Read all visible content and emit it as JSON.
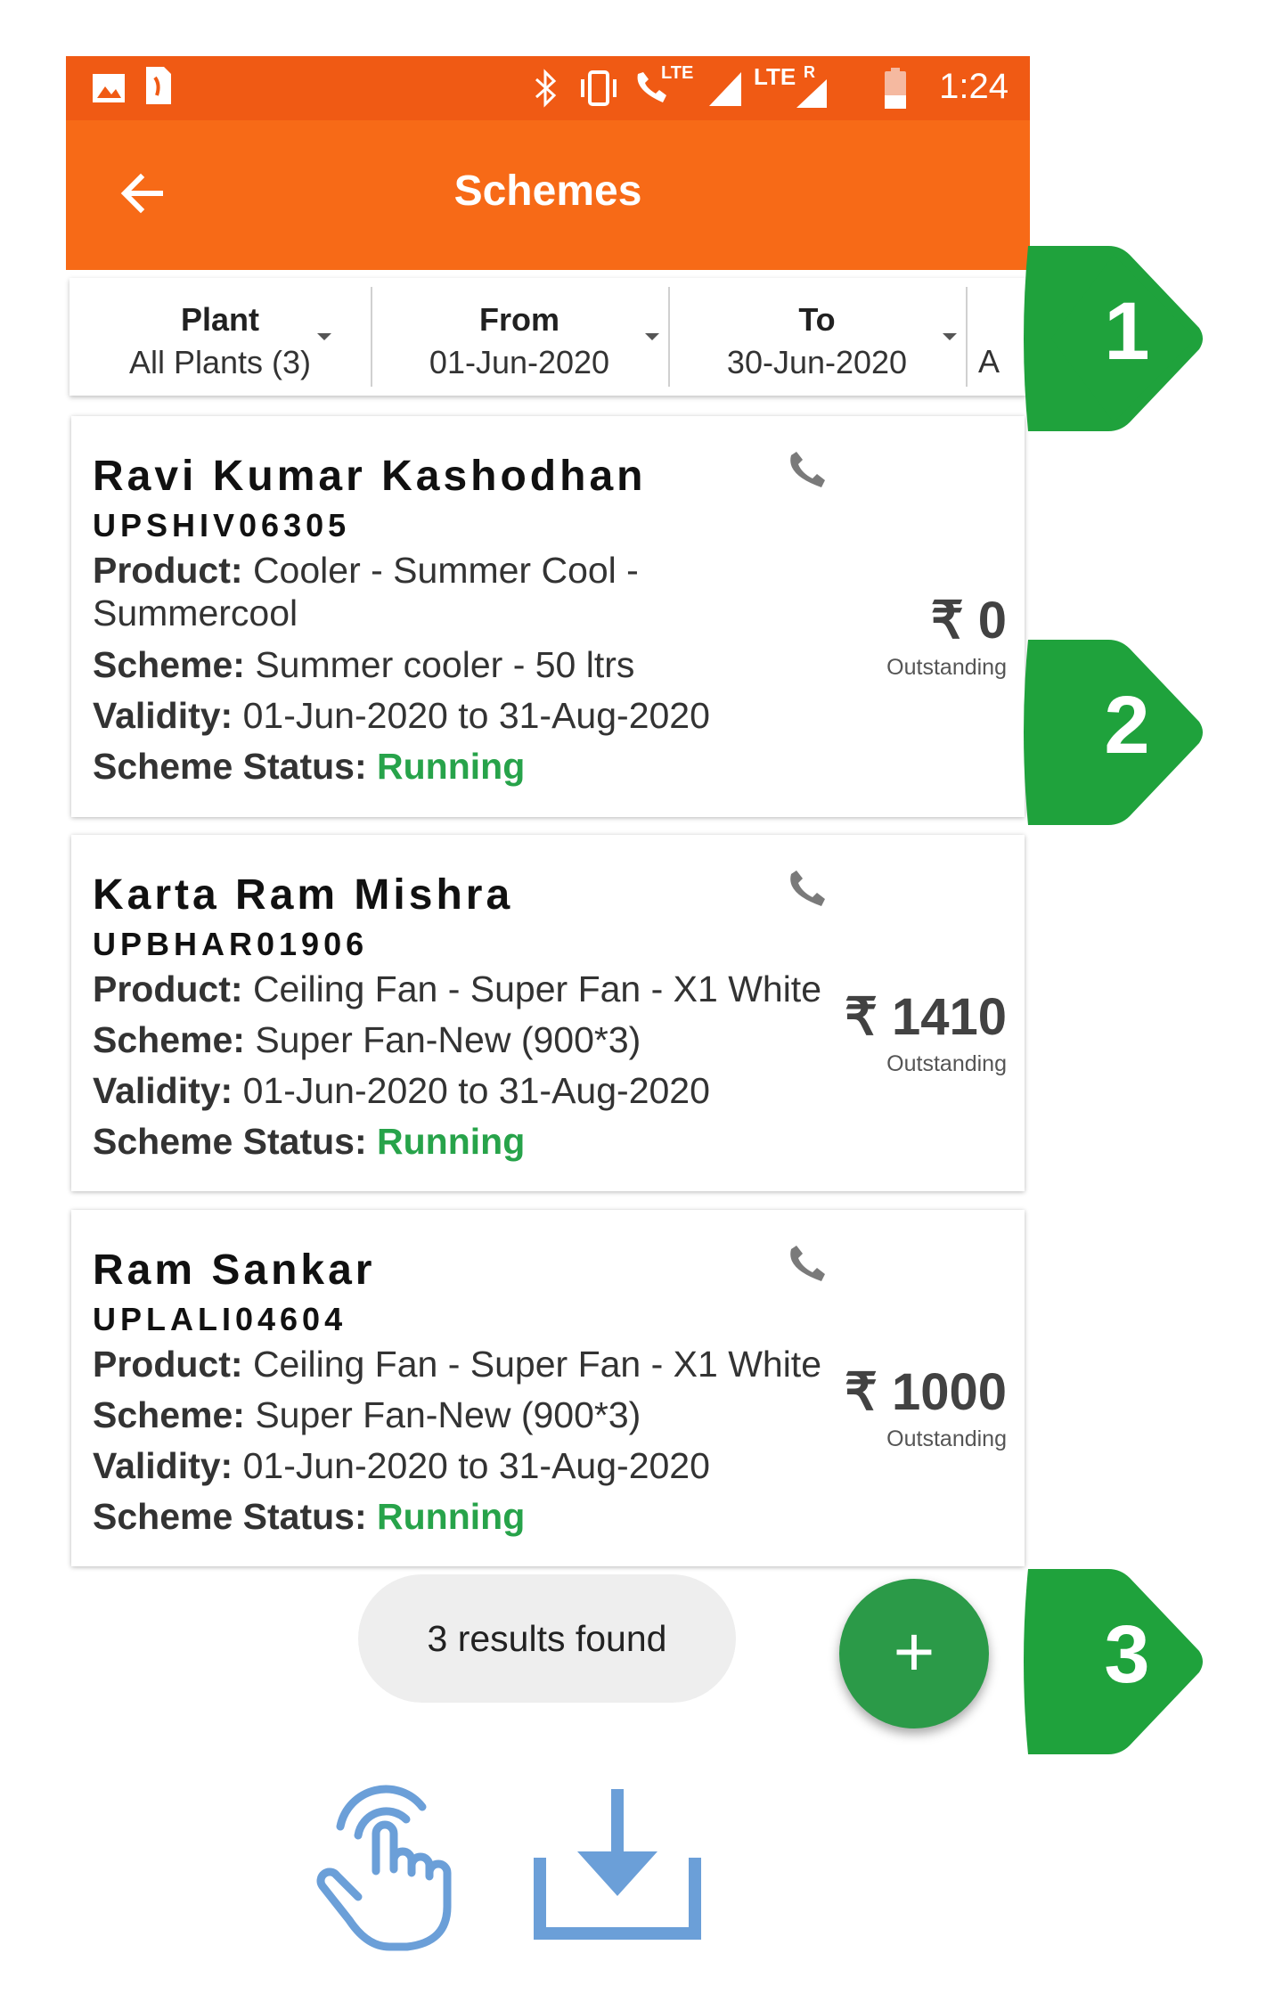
{
  "status_bar": {
    "time": "1:24",
    "network_1": "LTE",
    "network_2": "LTE",
    "roaming": "R"
  },
  "app_bar": {
    "title": "Schemes"
  },
  "filters": [
    {
      "label": "Plant",
      "value": "All Plants (3)"
    },
    {
      "label": "From",
      "value": "01-Jun-2020"
    },
    {
      "label": "To",
      "value": "30-Jun-2020"
    },
    {
      "label": "",
      "value": "A"
    }
  ],
  "cards": [
    {
      "name": "Ravi Kumar Kashodhan",
      "code": "UPSHIV06305",
      "product_label": "Product:",
      "product_line1": "Cooler - Summer Cool -",
      "product_line2": "Summercool",
      "scheme_label": "Scheme:",
      "scheme": "Summer cooler - 50 ltrs",
      "validity_label": "Validity:",
      "validity": "01-Jun-2020 to 31-Aug-2020",
      "status_label": "Scheme Status:",
      "status": "Running",
      "amount": "₹ 0",
      "amount_caption": "Outstanding"
    },
    {
      "name": "Karta Ram Mishra",
      "code": "UPBHAR01906",
      "product_label": "Product:",
      "product": "Ceiling Fan - Super Fan - X1 White",
      "scheme_label": "Scheme:",
      "scheme": "Super Fan-New  (900*3)",
      "validity_label": "Validity:",
      "validity": "01-Jun-2020 to 31-Aug-2020",
      "status_label": "Scheme Status:",
      "status": "Running",
      "amount": "₹ 1410",
      "amount_caption": "Outstanding"
    },
    {
      "name": "Ram Sankar",
      "code": "UPLALI04604",
      "product_label": "Product:",
      "product": "Ceiling Fan - Super Fan - X1 White",
      "scheme_label": "Scheme:",
      "scheme": "Super Fan-New  (900*3)",
      "validity_label": "Validity:",
      "validity": "01-Jun-2020 to 31-Aug-2020",
      "status_label": "Scheme Status:",
      "status": "Running",
      "amount": "₹ 1000",
      "amount_caption": "Outstanding"
    }
  ],
  "results_text": "3 results found",
  "fab_label": "+",
  "callouts": [
    "1",
    "2",
    "3"
  ],
  "icons": [
    "image-icon",
    "sim-icon",
    "bluetooth-icon",
    "vibrate-icon",
    "volte-call-icon",
    "signal-icon",
    "battery-icon",
    "back-arrow-icon",
    "phone-icon",
    "tap-hand-icon",
    "download-icon"
  ],
  "colors": {
    "status_bar": "#f05a14",
    "app_bar": "#f76a17",
    "running": "#27a34a",
    "fab": "#2b9a48",
    "callout": "#1fa23c",
    "bottom_icons": "#6b9fd8"
  }
}
